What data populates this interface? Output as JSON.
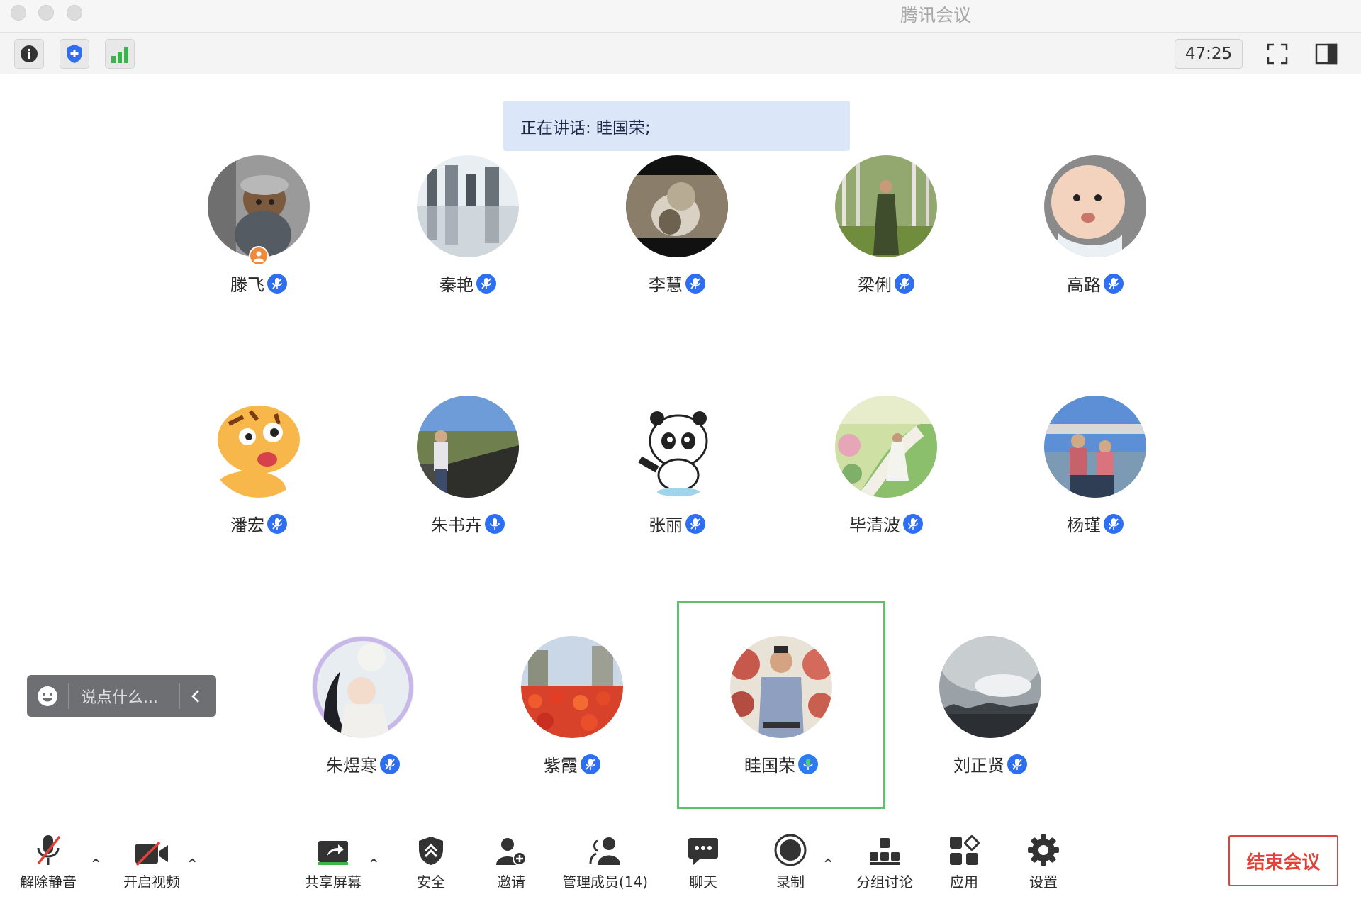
{
  "window": {
    "title": "腾讯会议"
  },
  "toolbar": {
    "timer": "47:25"
  },
  "speaking": {
    "text": "正在讲话: 眭国荣;"
  },
  "participants": [
    {
      "name": "滕飞",
      "host": true
    },
    {
      "name": "秦艳"
    },
    {
      "name": "李慧"
    },
    {
      "name": "梁俐"
    },
    {
      "name": "高路"
    },
    {
      "name": "潘宏"
    },
    {
      "name": "朱书卉"
    },
    {
      "name": "张丽"
    },
    {
      "name": "毕清波"
    },
    {
      "name": "杨瑾"
    },
    {
      "name": "朱煜寒"
    },
    {
      "name": "紫霞"
    },
    {
      "name": "眭国荣",
      "speaking": true
    },
    {
      "name": "刘正贤"
    }
  ],
  "chat": {
    "placeholder": "说点什么..."
  },
  "bottombar": {
    "unmute": "解除静音",
    "video": "开启视频",
    "share": "共享屏幕",
    "security": "安全",
    "invite": "邀请",
    "members": "管理成员(14)",
    "chat": "聊天",
    "record": "录制",
    "breakout": "分组讨论",
    "apps": "应用",
    "settings": "设置",
    "end": "结束会议"
  },
  "colors": {
    "accent": "#2d6ff0",
    "end": "#e2413a",
    "active": "#5dbf6f",
    "signal": "#3bb54a"
  }
}
